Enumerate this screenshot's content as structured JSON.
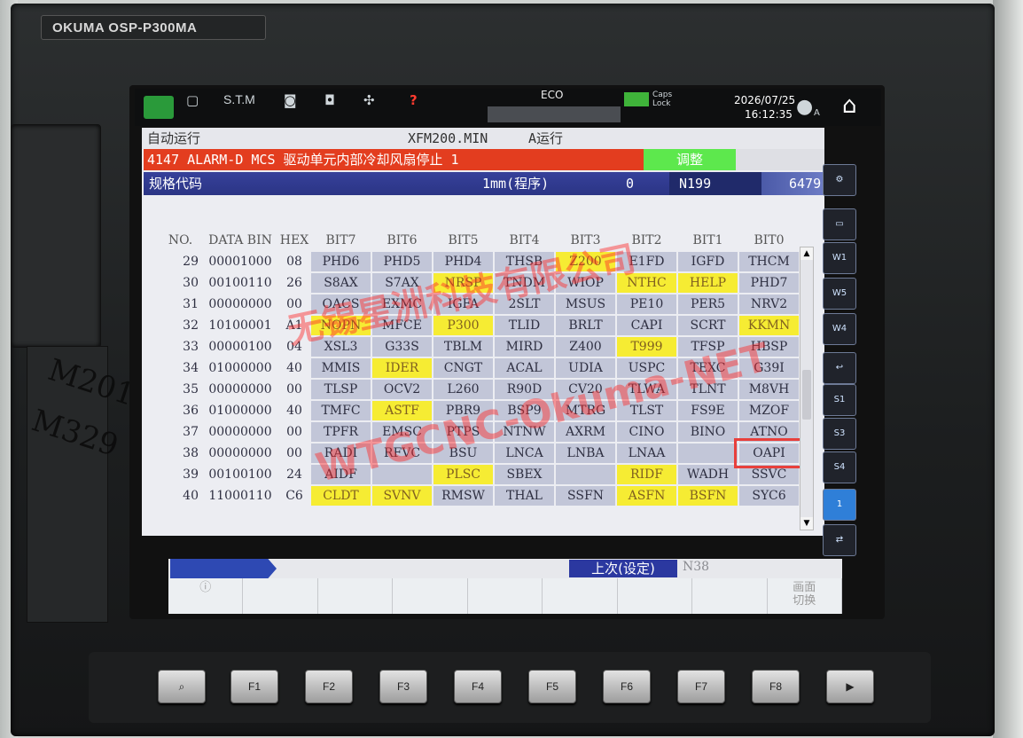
{
  "brand": "OKUMA  OSP-P300MA",
  "handwriting": "M201\nM329",
  "status_bar": {
    "stm": "S.T.M",
    "eco": "ECO",
    "caps_lock": "Caps Lock",
    "date": "2026/07/25",
    "time": "16:12:35",
    "user_mark": "A"
  },
  "mode_row": {
    "mode": "自动运行",
    "program": "XFM200.MIN",
    "run_state": "A运行"
  },
  "alarm_row": {
    "message": "4147 ALARM-D MCS 驱动单元内部冷却风扇停止 1",
    "adjust": "调整"
  },
  "spec_row": {
    "title": "规格代码",
    "unit": "1mm(程序)",
    "zero": "0",
    "n_number": "N199",
    "count": "6479"
  },
  "table": {
    "headers": [
      "NO.",
      "DATA BIN",
      "HEX",
      "BIT7",
      "BIT6",
      "BIT5",
      "BIT4",
      "BIT3",
      "BIT2",
      "BIT1",
      "BIT0"
    ],
    "rows": [
      {
        "no": "29",
        "bin": "00001000",
        "hex": "08",
        "bits": [
          "PHD6",
          "PHD5",
          "PHD4",
          "THSB",
          "Z200",
          "E1FD",
          "IGFD",
          "THCM"
        ]
      },
      {
        "no": "30",
        "bin": "00100110",
        "hex": "26",
        "bits": [
          "S8AX",
          "S7AX",
          "NRSP",
          "TNDM",
          "WIOP",
          "NTHC",
          "HELP",
          "PHD7"
        ]
      },
      {
        "no": "31",
        "bin": "00000000",
        "hex": "00",
        "bits": [
          "OACS",
          "EXMC",
          "IGFA",
          "2SLT",
          "MSUS",
          "PE10",
          "PER5",
          "NRV2"
        ]
      },
      {
        "no": "32",
        "bin": "10100001",
        "hex": "A1",
        "bits": [
          "NOPN",
          "MFCE",
          "P300",
          "TLID",
          "BRLT",
          "CAPI",
          "SCRT",
          "KKMN"
        ]
      },
      {
        "no": "33",
        "bin": "00000100",
        "hex": "04",
        "bits": [
          "XSL3",
          "G33S",
          "TBLM",
          "MIRD",
          "Z400",
          "T999",
          "TFSP",
          "HBSP"
        ]
      },
      {
        "no": "34",
        "bin": "01000000",
        "hex": "40",
        "bits": [
          "MMIS",
          "IDER",
          "CNGT",
          "ACAL",
          "UDIA",
          "USPC",
          "TEXC",
          "G39I"
        ]
      },
      {
        "no": "35",
        "bin": "00000000",
        "hex": "00",
        "bits": [
          "TLSP",
          "OCV2",
          "L260",
          "R90D",
          "CV20",
          "TLWA",
          "TLNT",
          "M8VH"
        ]
      },
      {
        "no": "36",
        "bin": "01000000",
        "hex": "40",
        "bits": [
          "TMFC",
          "ASTF",
          "PBR9",
          "BSP9",
          "MTRG",
          "TLST",
          "FS9E",
          "MZOF"
        ]
      },
      {
        "no": "37",
        "bin": "00000000",
        "hex": "00",
        "bits": [
          "TPFR",
          "EMSC",
          "PTPS",
          "NTNW",
          "AXRM",
          "CINO",
          "BINO",
          "ATNO"
        ]
      },
      {
        "no": "38",
        "bin": "00000000",
        "hex": "00",
        "bits": [
          "RADI",
          "RFVC",
          "BSU",
          "LNCA",
          "LNBA",
          "LNAA",
          "",
          "OAPI"
        ]
      },
      {
        "no": "39",
        "bin": "00100100",
        "hex": "24",
        "bits": [
          "AIDF",
          "",
          "PLSC",
          "SBEX",
          "",
          "RIDF",
          "WADH",
          "SSVC"
        ]
      },
      {
        "no": "40",
        "bin": "11000110",
        "hex": "C6",
        "bits": [
          "CLDT",
          "SVNV",
          "RMSW",
          "THAL",
          "SSFN",
          "ASFN",
          "BSFN",
          "SYC6"
        ]
      }
    ]
  },
  "sidetools": [
    "W1",
    "W5",
    "W4",
    "S1",
    "S3",
    "S4",
    "1"
  ],
  "bottom": {
    "previous": "上次(设定)",
    "n_value": "N38"
  },
  "softkeys": [
    "ⓘ",
    "",
    "",
    "",
    "",
    "",
    "",
    "",
    "画面\n切换"
  ],
  "fkeys": [
    "F1",
    "F2",
    "F3",
    "F4",
    "F5",
    "F6",
    "F7",
    "F8"
  ],
  "watermarks": [
    "无锡星洲科技有限公司",
    "WTGCNC-Okuma-NET"
  ],
  "colors": {
    "alarm": "#e33d1f",
    "adjust": "#5de84d",
    "spec": "#2b3585",
    "highlight": "#f6ec33",
    "selection": "#e8403c"
  }
}
